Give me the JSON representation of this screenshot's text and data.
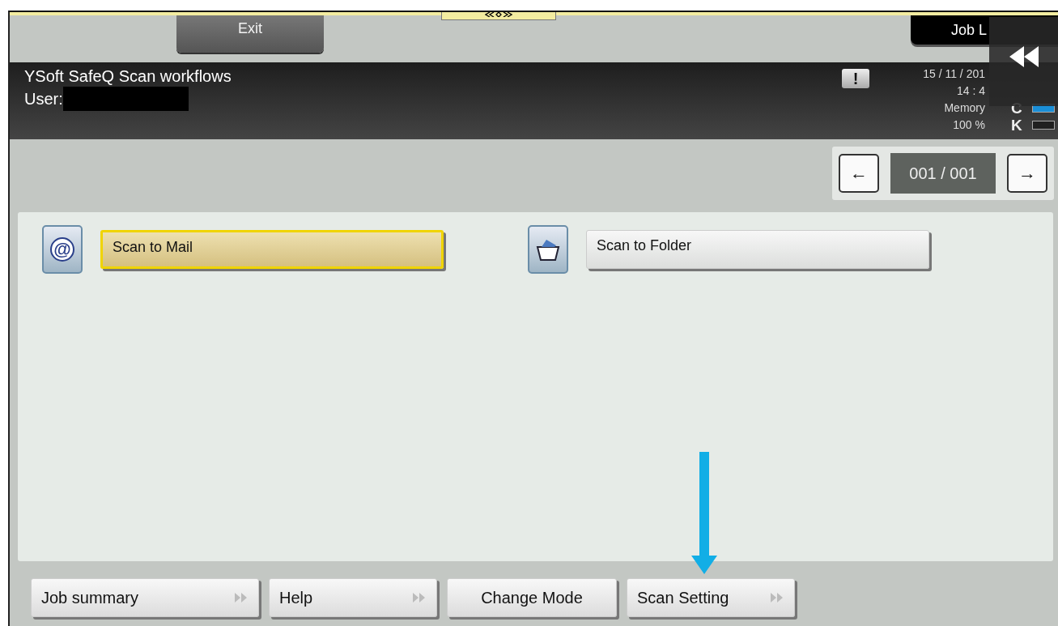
{
  "top_bar": {
    "exit_button": "Exit",
    "job_list_button": "Job L"
  },
  "header": {
    "title": "YSoft SafeQ Scan workflows",
    "user_label": "User:",
    "date": "15 / 11 / 201",
    "time": "14 : 4",
    "memory_label": "Memory",
    "memory_value": "100 %",
    "alert": "!",
    "toners": [
      {
        "letter": "C",
        "color": "#1a8fd8"
      },
      {
        "letter": "K",
        "color": "#202020"
      }
    ]
  },
  "pager": {
    "prev": "←",
    "page": "001 / 001",
    "next": "→"
  },
  "workflows": [
    {
      "label": "Scan to Mail",
      "kind": "mail",
      "icon": "@",
      "selected": true
    },
    {
      "label": "Scan to Folder",
      "kind": "folder",
      "selected": false
    }
  ],
  "bottom_buttons": [
    {
      "label": "Job summary",
      "kind": "expand"
    },
    {
      "label": "Help",
      "kind": "expand"
    },
    {
      "label": "Change Mode",
      "kind": "plain"
    },
    {
      "label": "Scan Setting",
      "kind": "expand"
    }
  ]
}
